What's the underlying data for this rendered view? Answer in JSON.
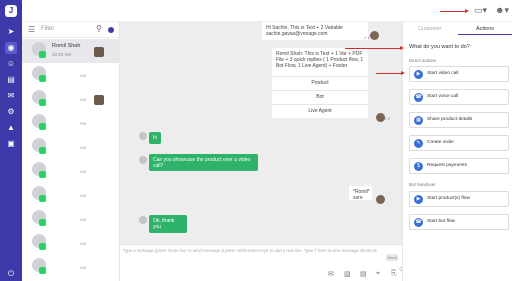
{
  "app": {
    "logo_letter": "J"
  },
  "rail": {
    "icons": [
      "send-icon",
      "chat-icon",
      "contacts-icon",
      "reports-icon",
      "campaign-icon",
      "settings-icon",
      "analytics-icon",
      "inbox-icon",
      "logout-icon"
    ]
  },
  "contacts": {
    "filter_label": "Filter",
    "items": [
      {
        "name": "Romil Shah",
        "time": "10:23 AM",
        "short": ""
      },
      {
        "name": "",
        "time": "",
        "short": "AM"
      },
      {
        "name": "",
        "time": "",
        "short": "AM"
      },
      {
        "name": "",
        "time": "",
        "short": "PM"
      },
      {
        "name": "",
        "time": "",
        "short": "AM"
      },
      {
        "name": "",
        "time": "",
        "short": "AM"
      },
      {
        "name": "",
        "time": "",
        "short": "AM"
      },
      {
        "name": "",
        "time": "",
        "short": "AM"
      },
      {
        "name": "",
        "time": "",
        "short": "AM"
      },
      {
        "name": "",
        "time": "",
        "short": "AM"
      }
    ]
  },
  "chat": {
    "msg1": "Hi Sachin, This is Text + 2 Variable sachin.gavas@vonage.com",
    "msg2": "Romil Shah: This is Text + 1 Var + PDF File + 3 quick replies ( 1 Product flow, 1 Bot Flow, 1 Live Agent) + Footer",
    "options": [
      "Product",
      "Bot",
      "Live Agent"
    ],
    "hi_reply": "hi",
    "question": "Can you showcase the product over a video call?",
    "romil_sure": "*Romil*\nsure",
    "ok_reply": "Ok, thank you"
  },
  "composer": {
    "placeholder": "Type a message (press 'Enter key' to send message & press 'Shift+Enter keys' to add a new line. Type '/' here to view message shortcuts",
    "send_label": "Send",
    "tools": [
      "whatsapp-template-icon",
      "image-icon",
      "document-icon",
      "location-icon",
      "attach-icon",
      "emoji-icon"
    ]
  },
  "panel": {
    "tabs": [
      "Customer",
      "Actions"
    ],
    "active_tab": "Actions",
    "title": "What do you want to do?",
    "direct_label": "Direct actions",
    "direct_actions": [
      "Start video call",
      "Start voice call",
      "Share product details",
      "Create order",
      "Request payments"
    ],
    "bot_label": "Bot handover",
    "bot_actions": [
      "Start product(s) flow",
      "Start bot flow"
    ]
  },
  "colors": {
    "rail": "#3b3aa8",
    "accent_green": "#2fb26a",
    "arrow_red": "#d12f2f"
  }
}
